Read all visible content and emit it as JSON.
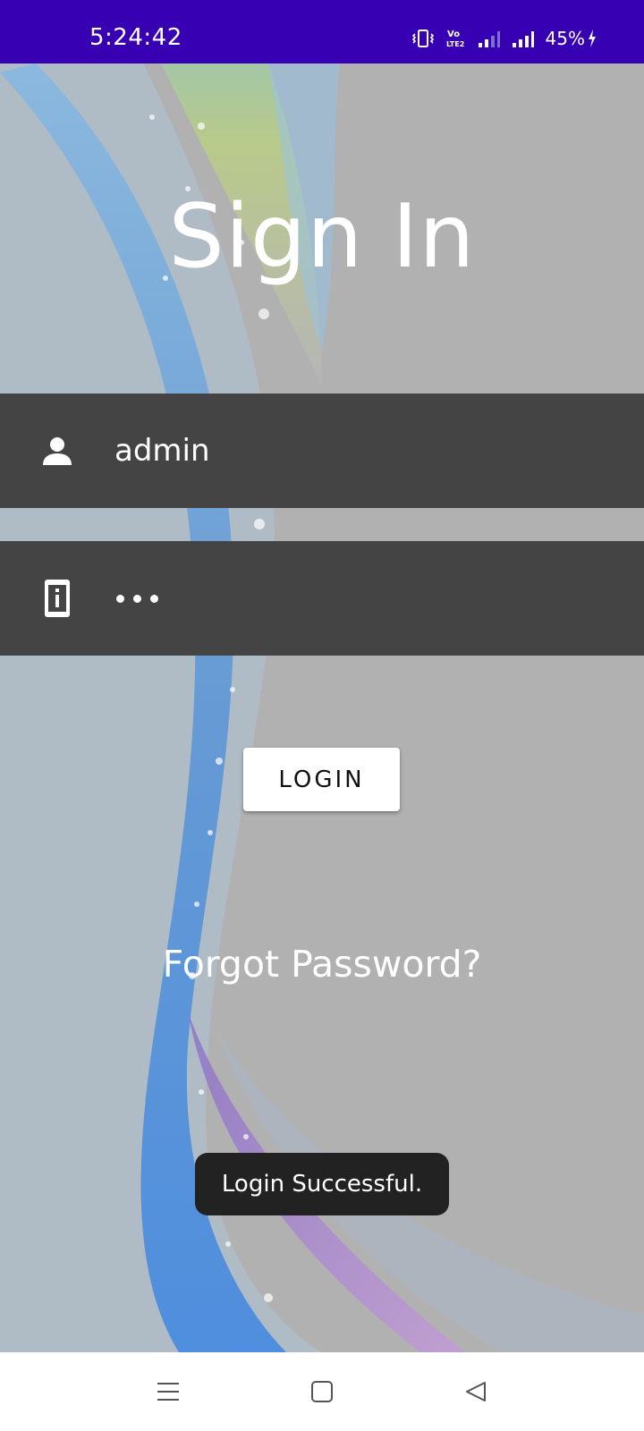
{
  "status_bar": {
    "time": "5:24:42",
    "battery": "45%",
    "icons": [
      "vibrate-icon",
      "volte-icon",
      "signal-weak-icon",
      "signal-icon",
      "charging-icon"
    ]
  },
  "screen": {
    "title": "Sign In"
  },
  "form": {
    "username_value": "admin",
    "username_icon": "person-icon",
    "password_icon": "info-card-icon",
    "password_masked": "•••",
    "login_label": "LOGIN"
  },
  "links": {
    "forgot_password": "Forgot Password?"
  },
  "toast": {
    "message": "Login Successful."
  },
  "nav_bar": {
    "icons": [
      "menu-icon",
      "home-icon",
      "back-icon"
    ]
  },
  "colors": {
    "status_bar_bg": "#3700b3",
    "field_bg": "#444444",
    "toast_bg": "#222222"
  }
}
